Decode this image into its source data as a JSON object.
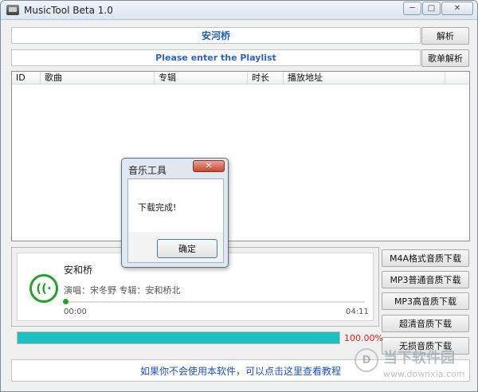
{
  "window": {
    "title": "MusicTool Beta 1.0",
    "controls": {
      "minimize": "─",
      "maximize": "□",
      "close": "✕"
    }
  },
  "input": {
    "song_name": "安河桥",
    "parse_label": "解析",
    "playlist_placeholder": "Please enter the Playlist",
    "playlist_parse_label": "歌单解析"
  },
  "table": {
    "columns": [
      "ID",
      "歌曲",
      "专辑",
      "时长",
      "播放地址"
    ],
    "rows": []
  },
  "player": {
    "song_name": "安和桥",
    "meta": "演唱：宋冬野 专辑：安和桥北",
    "current_time": "00:00",
    "total_time": "04:11",
    "position_fraction": 0.0
  },
  "downloads": {
    "m4a": "M4A格式音质下载",
    "mp3_normal": "MP3普通音质下载",
    "mp3_high": "MP3高音质下载",
    "hq": "超清音质下载",
    "lossless": "无损音质下载"
  },
  "progress": {
    "value": 1.0,
    "label": "100.00%"
  },
  "help": {
    "text": "如果你不会使用本软件，可以点击这里查看教程"
  },
  "dialog": {
    "title": "音乐工具",
    "close_glyph": "✕",
    "message": "下载完成!",
    "ok_label": "确定"
  },
  "watermark": {
    "title": "当下软件园",
    "url": "www.downxia.com",
    "logo_glyph": "D"
  },
  "colors": {
    "accent_green": "#23a325",
    "progress_fill": "#1cc0c0",
    "progress_text": "#e02020",
    "link_blue": "#1d4fd1"
  }
}
